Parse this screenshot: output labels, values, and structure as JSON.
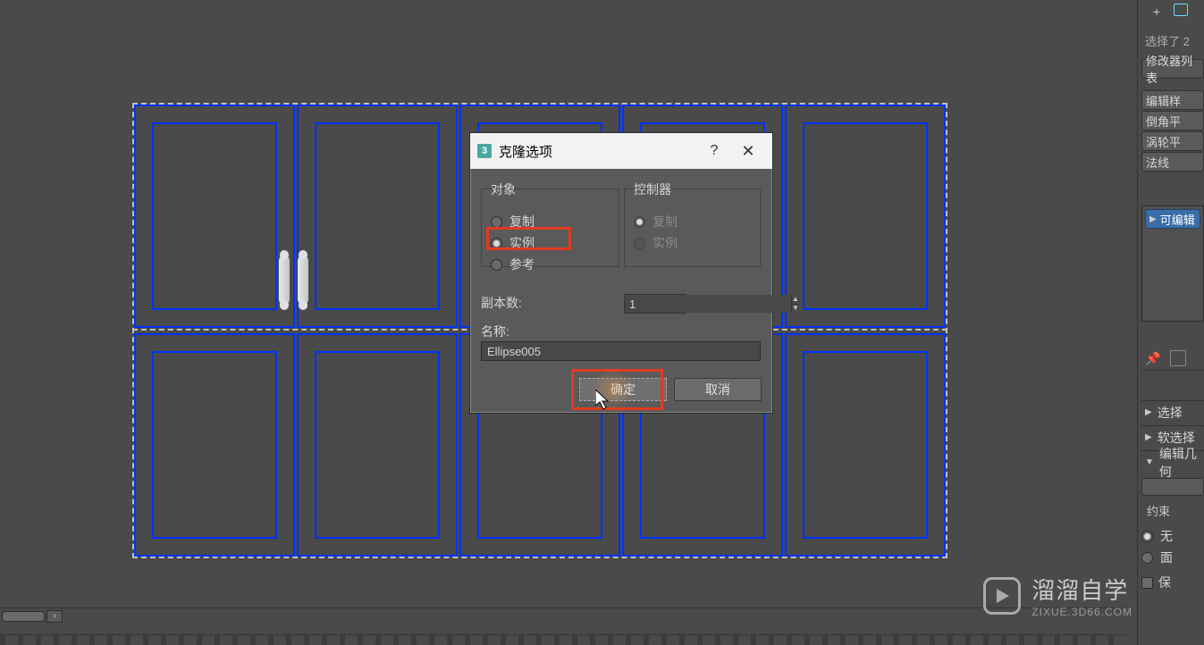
{
  "dialog": {
    "app_icon_text": "3",
    "title": "克隆选项",
    "help": "?",
    "close": "✕",
    "object_group": "对象",
    "controller_group": "控制器",
    "obj_copy": "复制",
    "obj_instance": "实例",
    "obj_reference": "参考",
    "ctrl_copy": "复制",
    "ctrl_instance": "实例",
    "copies_label": "副本数:",
    "copies_value": "1",
    "name_label": "名称:",
    "name_value": "Ellipse005",
    "ok": "确定",
    "cancel": "取消"
  },
  "side": {
    "selection_info": "选择了 2",
    "mod_list_label": "修改器列表",
    "stack_btn1": "编辑样",
    "stack_btn2": "倒角平",
    "stack_btn3": "涡轮平",
    "stack_btn4": "法线",
    "stack_selected": "可编辑",
    "rollout_select": "选择",
    "rollout_softsel": "软选择",
    "rollout_editgeo": "编辑几何",
    "constraint_label": "约束",
    "opt_none": "无",
    "opt_face": "面",
    "opt_preserve": "保"
  },
  "watermark": {
    "title": "溜溜自学",
    "sub": "ZIXUE.3D66.COM"
  }
}
